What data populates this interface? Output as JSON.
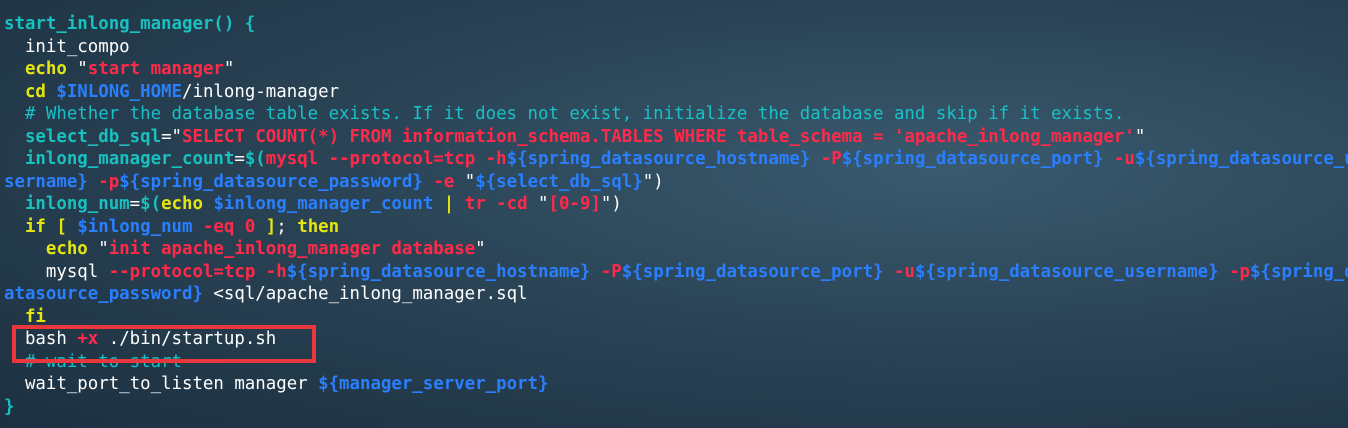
{
  "code": {
    "lines": [
      [
        {
          "t": "start_inlong_manager() {",
          "c": "fn"
        }
      ],
      [
        {
          "t": "  init_compo",
          "c": "def"
        }
      ],
      [
        {
          "t": "  echo ",
          "c": "kw"
        },
        {
          "t": "\"",
          "c": "q"
        },
        {
          "t": "start manager",
          "c": "str"
        },
        {
          "t": "\"",
          "c": "q"
        }
      ],
      [
        {
          "t": "  cd ",
          "c": "kw"
        },
        {
          "t": "$INLONG_HOME",
          "c": "var"
        },
        {
          "t": "/inlong-manager",
          "c": "def"
        }
      ],
      [
        {
          "t": "  # Whether the database table exists. If it does not exist, initialize the database and skip if it exists.",
          "c": "cmt"
        }
      ],
      [
        {
          "t": "  select_db_sql",
          "c": "fn"
        },
        {
          "t": "=",
          "c": "pun"
        },
        {
          "t": "\"",
          "c": "q"
        },
        {
          "t": "SELECT COUNT(*) FROM information_schema.TABLES WHERE table_schema = 'apache_inlong_manager'",
          "c": "str"
        },
        {
          "t": "\"",
          "c": "q"
        }
      ],
      [
        {
          "t": "  inlong_manager_count",
          "c": "fn"
        },
        {
          "t": "=",
          "c": "pun"
        },
        {
          "t": "$(",
          "c": "br"
        },
        {
          "t": "mysql ",
          "c": "str"
        },
        {
          "t": "--protocol=tcp ",
          "c": "opt"
        },
        {
          "t": "-h",
          "c": "opt"
        },
        {
          "t": "${spring_datasource_hostname} ",
          "c": "var"
        },
        {
          "t": "-P",
          "c": "opt"
        },
        {
          "t": "${spring_datasource_port} ",
          "c": "var"
        },
        {
          "t": "-u",
          "c": "opt"
        },
        {
          "t": "${spring_datasource_u",
          "c": "var"
        }
      ],
      [
        {
          "t": "sername} ",
          "c": "var"
        },
        {
          "t": "-p",
          "c": "opt"
        },
        {
          "t": "${spring_datasource_password} ",
          "c": "var"
        },
        {
          "t": "-e ",
          "c": "opt"
        },
        {
          "t": "\"",
          "c": "q"
        },
        {
          "t": "${select_db_sql}",
          "c": "var"
        },
        {
          "t": "\")",
          "c": "q"
        }
      ],
      [
        {
          "t": "  inlong_num",
          "c": "fn"
        },
        {
          "t": "=",
          "c": "pun"
        },
        {
          "t": "$(",
          "c": "br"
        },
        {
          "t": "echo ",
          "c": "yl"
        },
        {
          "t": "$inlong_manager_count ",
          "c": "var"
        },
        {
          "t": "| ",
          "c": "yl"
        },
        {
          "t": "tr ",
          "c": "str"
        },
        {
          "t": "-cd ",
          "c": "opt"
        },
        {
          "t": "\"",
          "c": "q"
        },
        {
          "t": "[0-9]",
          "c": "str"
        },
        {
          "t": "\")",
          "c": "q"
        }
      ],
      [
        {
          "t": "  if ",
          "c": "kw"
        },
        {
          "t": "[ ",
          "c": "yl"
        },
        {
          "t": "$inlong_num ",
          "c": "var"
        },
        {
          "t": "-eq ",
          "c": "opt"
        },
        {
          "t": "0 ",
          "c": "str"
        },
        {
          "t": "]",
          "c": "yl"
        },
        {
          "t": "; ",
          "c": "pun"
        },
        {
          "t": "then",
          "c": "kw"
        }
      ],
      [
        {
          "t": "    echo ",
          "c": "kw"
        },
        {
          "t": "\"",
          "c": "q"
        },
        {
          "t": "init apache_inlong_manager database",
          "c": "str"
        },
        {
          "t": "\"",
          "c": "q"
        }
      ],
      [
        {
          "t": "    mysql ",
          "c": "def"
        },
        {
          "t": "--protocol=tcp ",
          "c": "opt"
        },
        {
          "t": "-h",
          "c": "opt"
        },
        {
          "t": "${spring_datasource_hostname} ",
          "c": "var"
        },
        {
          "t": "-P",
          "c": "opt"
        },
        {
          "t": "${spring_datasource_port} ",
          "c": "var"
        },
        {
          "t": "-u",
          "c": "opt"
        },
        {
          "t": "${spring_datasource_username} ",
          "c": "var"
        },
        {
          "t": "-p",
          "c": "opt"
        },
        {
          "t": "${spring_d",
          "c": "var"
        }
      ],
      [
        {
          "t": "atasource_password} ",
          "c": "var"
        },
        {
          "t": "<sql/apache_inlong_manager.sql",
          "c": "def"
        }
      ],
      [
        {
          "t": "  fi",
          "c": "kw"
        }
      ],
      [
        {
          "t": "  bash ",
          "c": "def"
        },
        {
          "t": "+x ",
          "c": "opt"
        },
        {
          "t": "./bin/startup.sh",
          "c": "def"
        }
      ],
      [
        {
          "t": "  # wait to start",
          "c": "cmt"
        }
      ],
      [
        {
          "t": "  wait_port_to_listen manager ",
          "c": "def"
        },
        {
          "t": "${manager_server_port}",
          "c": "var"
        }
      ],
      [
        {
          "t": "}",
          "c": "fn"
        }
      ]
    ]
  },
  "highlight": {
    "color": "#e8383e",
    "target": "bash +x ./bin/startup.sh"
  }
}
